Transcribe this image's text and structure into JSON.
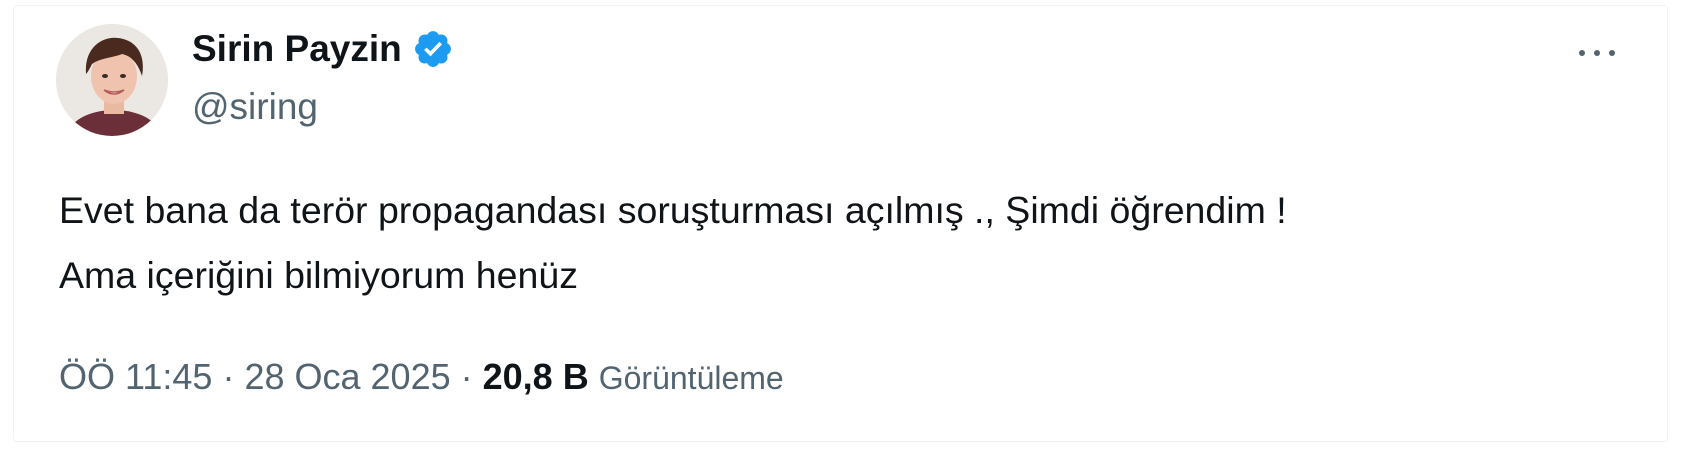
{
  "author": {
    "display_name": "Sirin Payzin",
    "handle": "@siring",
    "verified_icon": "verified-badge-icon",
    "verified_color": "#1d9bf0"
  },
  "menu": {
    "icon": "more-horizontal-icon"
  },
  "tweet": {
    "lines": [
      "Evet bana da terör propagandası soruşturması açılmış ., Şimdi öğrendim !",
      "Ama içeriğini bilmiyorum henüz"
    ]
  },
  "meta": {
    "time": "ÖÖ 11:45",
    "separator": "·",
    "date": "28 Oca 2025",
    "views_count": "20,8 B",
    "views_label": "Görüntüleme"
  },
  "colors": {
    "text": "#0f1419",
    "secondary": "#536471"
  }
}
